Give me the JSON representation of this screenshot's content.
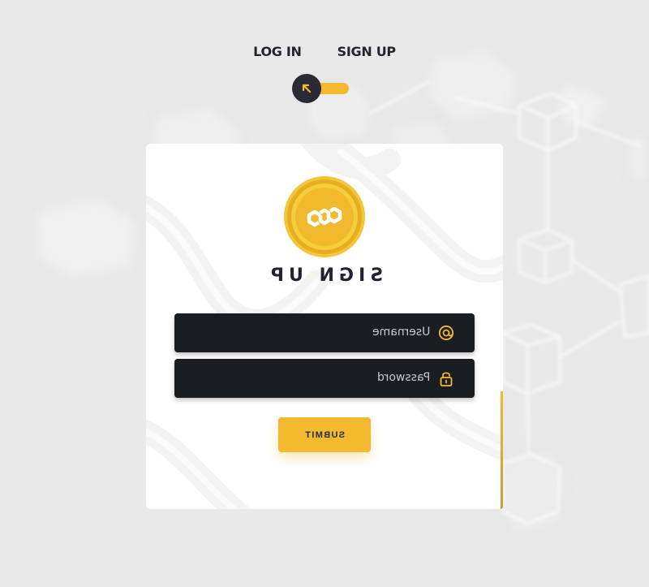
{
  "tabs": {
    "login": "LOG IN",
    "signup": "SIGN UP"
  },
  "toggle": {
    "icon": "arrow-up-left-icon"
  },
  "card": {
    "logo": "polygon-coin-logo",
    "title": "SIGN UP",
    "username": {
      "placeholder": "Username",
      "icon": "at-sign-icon"
    },
    "password": {
      "placeholder": "Password",
      "icon": "lock-icon"
    },
    "submit_label": "SUBMIT"
  },
  "colors": {
    "accent": "#f3b92f",
    "dark": "#2a2a35",
    "input_bg": "#1a1d22",
    "page_bg": "#e9e9e9"
  }
}
